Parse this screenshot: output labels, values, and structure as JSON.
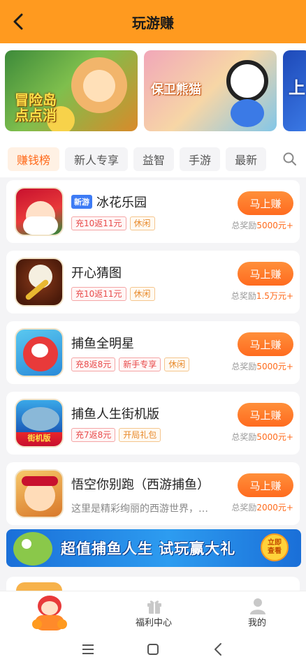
{
  "header": {
    "title": "玩游赚",
    "back_icon": "chevron-left-icon",
    "background": "#ff9a1f"
  },
  "banners": [
    {
      "title": "冒险岛点点消"
    },
    {
      "title": "保卫熊猫"
    },
    {
      "title": "上"
    }
  ],
  "tabs": [
    {
      "label": "赚钱榜",
      "active": true
    },
    {
      "label": "新人专享",
      "active": false
    },
    {
      "label": "益智",
      "active": false
    },
    {
      "label": "手游",
      "active": false
    },
    {
      "label": "最新",
      "active": false
    }
  ],
  "search_icon": "search-icon",
  "games": [
    {
      "name": "冰花乐园",
      "badge": "新游",
      "tags": [
        "充10返11元",
        "休闲"
      ],
      "button": "马上赚",
      "reward_prefix": "总奖励",
      "reward_amount": "5000元+"
    },
    {
      "name": "开心猜图",
      "tags": [
        "充10返11元",
        "休闲"
      ],
      "button": "马上赚",
      "reward_prefix": "总奖励",
      "reward_amount": "1.5万元+"
    },
    {
      "name": "捕鱼全明星",
      "tags": [
        "充8返8元",
        "新手专享",
        "休闲"
      ],
      "button": "马上赚",
      "reward_prefix": "总奖励",
      "reward_amount": "5000元+"
    },
    {
      "name": "捕鱼人生街机版",
      "tags": [
        "充7返8元",
        "开局礼包"
      ],
      "button": "马上赚",
      "reward_prefix": "总奖励",
      "reward_amount": "5000元+"
    },
    {
      "name": "悟空你别跑（西游捕鱼）",
      "description": "这里是精彩绚丽的西游世界，…",
      "button": "马上赚",
      "reward_prefix": "总奖励",
      "reward_amount": "2000元+"
    }
  ],
  "promo": {
    "text": "超值捕鱼人生 试玩赢大礼",
    "button_line1": "立即",
    "button_line2": "查看"
  },
  "game_icon_badge": "街机版",
  "bottom_nav": {
    "welfare_label": "福利中心",
    "mine_label": "我的"
  },
  "colors": {
    "accent": "#ff6a1a",
    "tag_red": "#e84a4a",
    "tag_orange": "#e8892a",
    "new_badge": "#3d7bf5"
  }
}
